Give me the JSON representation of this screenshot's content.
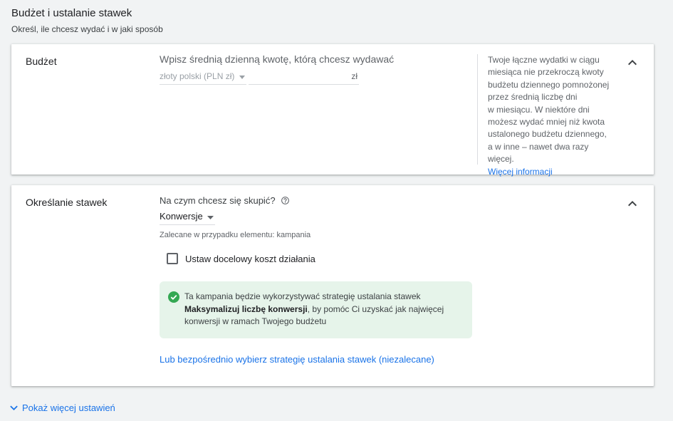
{
  "section": {
    "title": "Budżet i ustalanie stawek",
    "subtitle": "Określ, ile chcesz wydać i w jaki sposób"
  },
  "budget": {
    "title": "Budżet",
    "prompt": "Wpisz średnią dzienną kwotę, którą chcesz wydawać",
    "currency": "złoty polski (PLN zł)",
    "amount_value": "",
    "amount_unit": "zł",
    "help_lines": [
      "Twoje łączne wydatki w ciągu",
      "miesiąca nie przekroczą kwoty",
      "budżetu dziennego pomnożonej",
      "przez średnią liczbę dni",
      "w miesiącu. W niektóre dni",
      "możesz wydać mniej niż kwota",
      "ustalonego budżetu dziennego,",
      "a w inne – nawet dwa razy więcej."
    ],
    "help_link": "Więcej informacji"
  },
  "bidding": {
    "title": "Określanie stawek",
    "focus_question": "Na czym chcesz się skupić?",
    "focus_value": "Konwersje",
    "recommended": "Zalecane w przypadku elementu: kampania",
    "checkbox_label": "Ustaw docelowy koszt działania",
    "checkbox_checked": false,
    "info_text_1": "Ta kampania będzie wykorzystywać strategię ustalania stawek",
    "info_bold": "Maksymalizuj liczbę konwersji",
    "info_text_2": ", by pomóc Ci uzyskać jak najwięcej konwersji w ramach Twojego budżetu",
    "direct_link": "Lub bezpośrednio wybierz strategię ustalania stawek (niezalecane)"
  },
  "show_more": "Pokaż więcej ustawień",
  "colors": {
    "background": "#f1f3f4",
    "card": "#ffffff",
    "link": "#1a73e8",
    "success": "#34a853",
    "success_bg": "#e6f4ea"
  },
  "icons": {
    "collapse": "chevron-up-icon",
    "dropdown": "caret-down-icon",
    "help": "help-circle-icon",
    "success": "check-circle-icon",
    "expand": "chevron-down-icon"
  }
}
